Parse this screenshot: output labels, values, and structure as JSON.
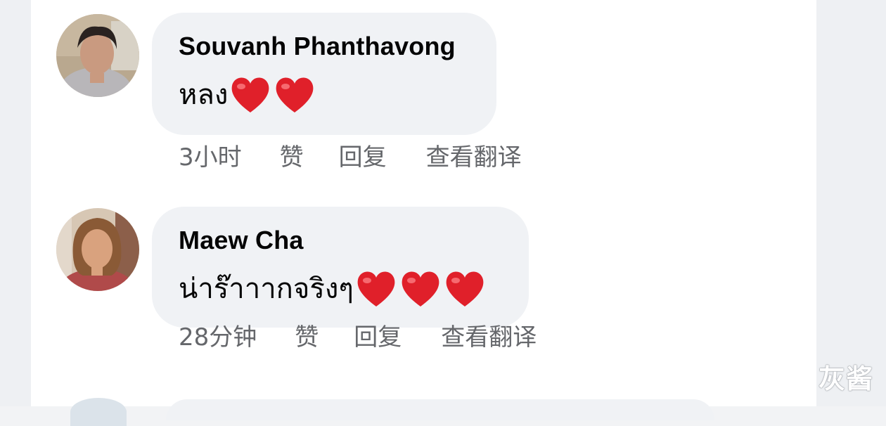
{
  "comments": [
    {
      "author": "Souvanh Phanthavong",
      "text": "หลง",
      "emoji": "heart-emoji",
      "heart_count": 2,
      "actions": {
        "time": "3小时",
        "like": "赞",
        "reply": "回复",
        "translate": "查看翻译"
      }
    },
    {
      "author": "Maew Cha",
      "text": "น่าร๊าาากจริงๆ",
      "emoji": "heart-emoji",
      "heart_count": 3,
      "actions": {
        "time": "28分钟",
        "like": "赞",
        "reply": "回复",
        "translate": "查看翻译"
      }
    }
  ],
  "watermark": "灰酱",
  "colors": {
    "bubble": "#f0f2f5",
    "secondary_text": "#65676b",
    "primary_text": "#050505",
    "heart": "#e0202a"
  }
}
